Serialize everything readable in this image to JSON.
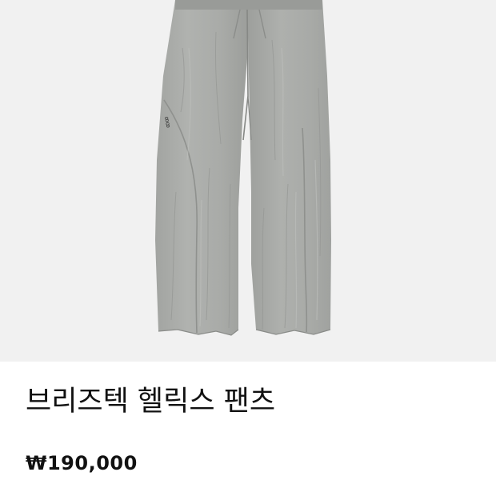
{
  "product": {
    "image_subject": "gray wide-leg pants",
    "title": "브리즈텍 헬릭스 팬츠",
    "price": "₩190,000"
  },
  "colors": {
    "image_background": "#f1f1f1",
    "fabric": "#a7a9a6",
    "text": "#111111"
  }
}
